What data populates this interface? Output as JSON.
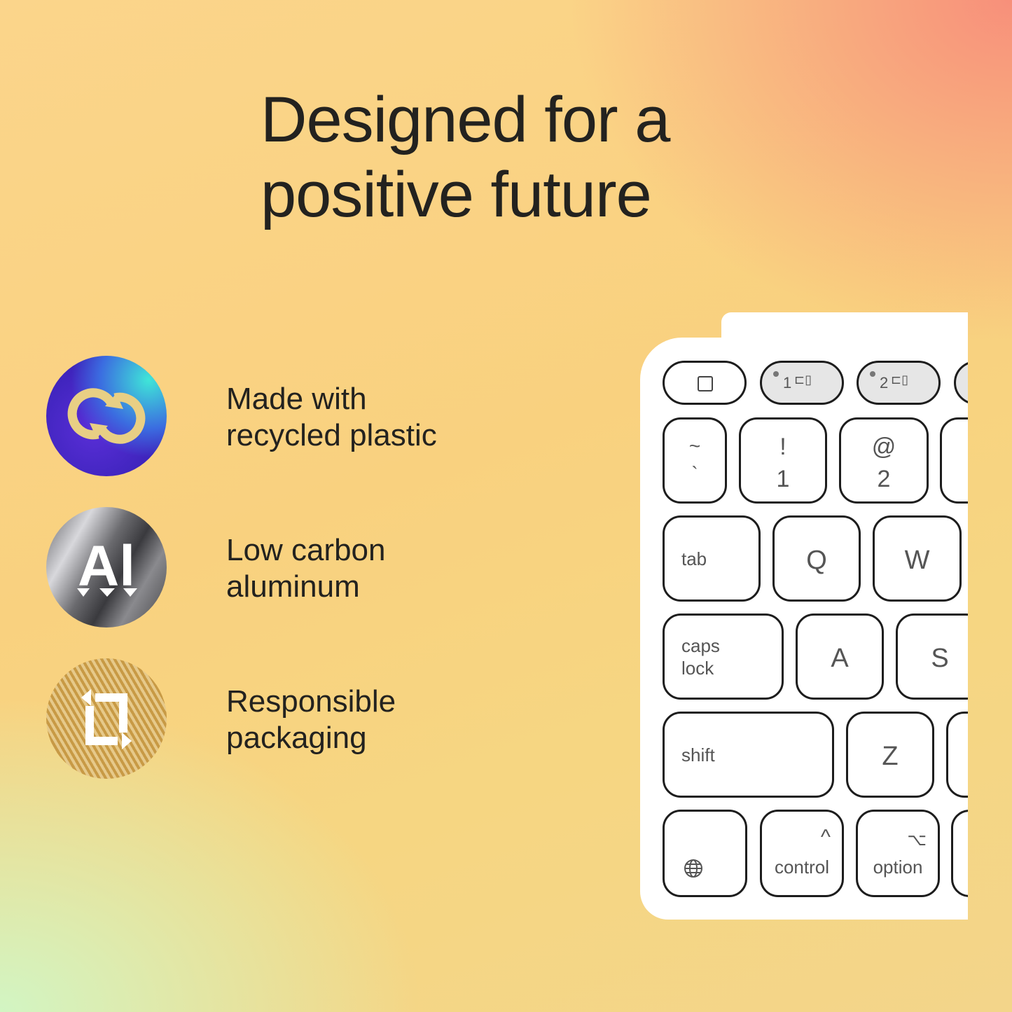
{
  "headline": {
    "line1": "Designed for a",
    "line2": "positive future"
  },
  "features": [
    {
      "icon": "recycle-icon",
      "line1": "Made with",
      "line2": "recycled plastic"
    },
    {
      "icon": "aluminum-icon",
      "badge_text": "Al",
      "line1": "Low carbon",
      "line2": "aluminum"
    },
    {
      "icon": "packaging-icon",
      "line1": "Responsible",
      "line2": "packaging"
    }
  ],
  "keyboard": {
    "easy_switch_1": "1",
    "easy_switch_2": "2",
    "tilde": "~",
    "backtick": "`",
    "excl": "!",
    "one": "1",
    "at": "@",
    "two": "2",
    "tab": "tab",
    "q": "Q",
    "w": "W",
    "caps1": "caps",
    "caps2": "lock",
    "a": "A",
    "s": "S",
    "shift": "shift",
    "z": "Z",
    "control_symbol": "^",
    "control": "control",
    "option_symbol": "⌥",
    "option": "option"
  },
  "colors": {
    "text": "#23221f",
    "key_border": "#1d1d1d",
    "gray_key": "#e6e6e6"
  }
}
